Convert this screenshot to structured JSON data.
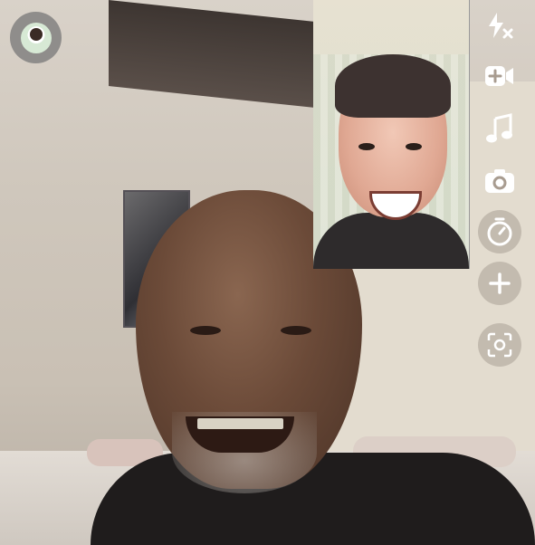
{
  "window": {
    "title": ""
  },
  "avatar": {
    "icon": "bitmoji-avatar-icon"
  },
  "toolbar": {
    "items": [
      {
        "icon": "flash-off-icon"
      },
      {
        "icon": "video-add-icon"
      },
      {
        "icon": "music-note-icon"
      },
      {
        "icon": "flip-camera-icon"
      },
      {
        "icon": "timer-icon"
      },
      {
        "icon": "plus-icon"
      },
      {
        "icon": "scan-icon"
      }
    ]
  },
  "colors": {
    "toolbar_icon": "#ffffff",
    "button_bg": "#a89c90"
  }
}
